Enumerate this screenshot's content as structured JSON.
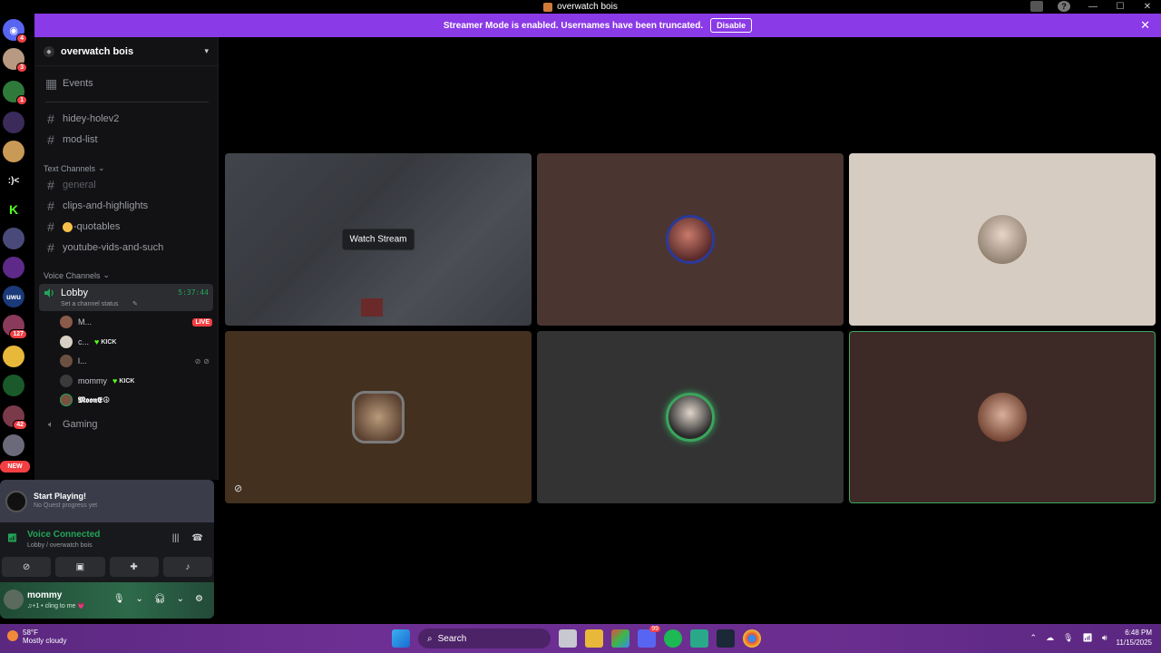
{
  "window": {
    "title": "overwatch bois"
  },
  "banner": {
    "message": "Streamer Mode is enabled. Usernames have been truncated.",
    "disable_label": "Disable"
  },
  "rail": {
    "badges": [
      "4",
      "3",
      "1",
      "127",
      "42"
    ],
    "glyphs": [
      ":)<",
      "K",
      "uwu"
    ],
    "new_label": "NEW"
  },
  "guild": {
    "name": "overwatch bois"
  },
  "sidebar": {
    "events_label": "Events",
    "top_channels": [
      "hidey-holev2",
      "mod-list"
    ],
    "text_category": "Text Channels",
    "text_channels": [
      "general",
      "clips-and-highlights",
      "-quotables",
      "youtube-vids-and-such"
    ],
    "voice_category": "Voice Channels",
    "lobby": {
      "name": "Lobby",
      "status": "Set a channel status",
      "timer": "5:37:44"
    },
    "voice_users": [
      {
        "name": "M...",
        "tag": "",
        "live": "LIVE"
      },
      {
        "name": "c...",
        "tag": "KICK",
        "live": ""
      },
      {
        "name": "l...",
        "tag": "",
        "live": ""
      },
      {
        "name": "mommy",
        "tag": "KICK",
        "live": ""
      },
      {
        "name": "𝕸𝖔𝖔𝖓𝕰☮",
        "tag": "",
        "live": ""
      }
    ],
    "gaming_label": "Gaming"
  },
  "quest": {
    "title": "Start Playing!",
    "subtitle": "No Quest progress yet"
  },
  "voice_panel": {
    "title": "Voice Connected",
    "subtitle": "Lobby / overwatch bois"
  },
  "user_panel": {
    "name": "mommy",
    "status": "♫+1 • cling to me 💗"
  },
  "stage": {
    "watch_label": "Watch Stream"
  },
  "taskbar": {
    "temperature": "58°F",
    "condition": "Mostly cloudy",
    "search_label": "Search",
    "discord_badge": "99",
    "time": "6:48 PM",
    "date": "11/15/2025"
  },
  "colors": {
    "accent": "#8a3ae6",
    "voice_green": "#23a559",
    "live_red": "#f23f43",
    "tile_brown": "#4a3530",
    "tile_beige": "#d6ccc2",
    "tile_dark": "#333333",
    "speaking_border": "#3ba55d"
  }
}
